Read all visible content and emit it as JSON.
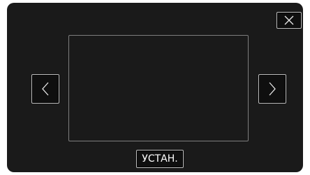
{
  "controls": {
    "close_icon": "close-icon",
    "prev_icon": "chevron-left-icon",
    "next_icon": "chevron-right-icon",
    "set_label": "УСТАН."
  },
  "colors": {
    "background": "#1a1a1a",
    "button_border": "#bdbdbd",
    "frame_border": "#7e7e7e",
    "text": "#ffffff"
  }
}
